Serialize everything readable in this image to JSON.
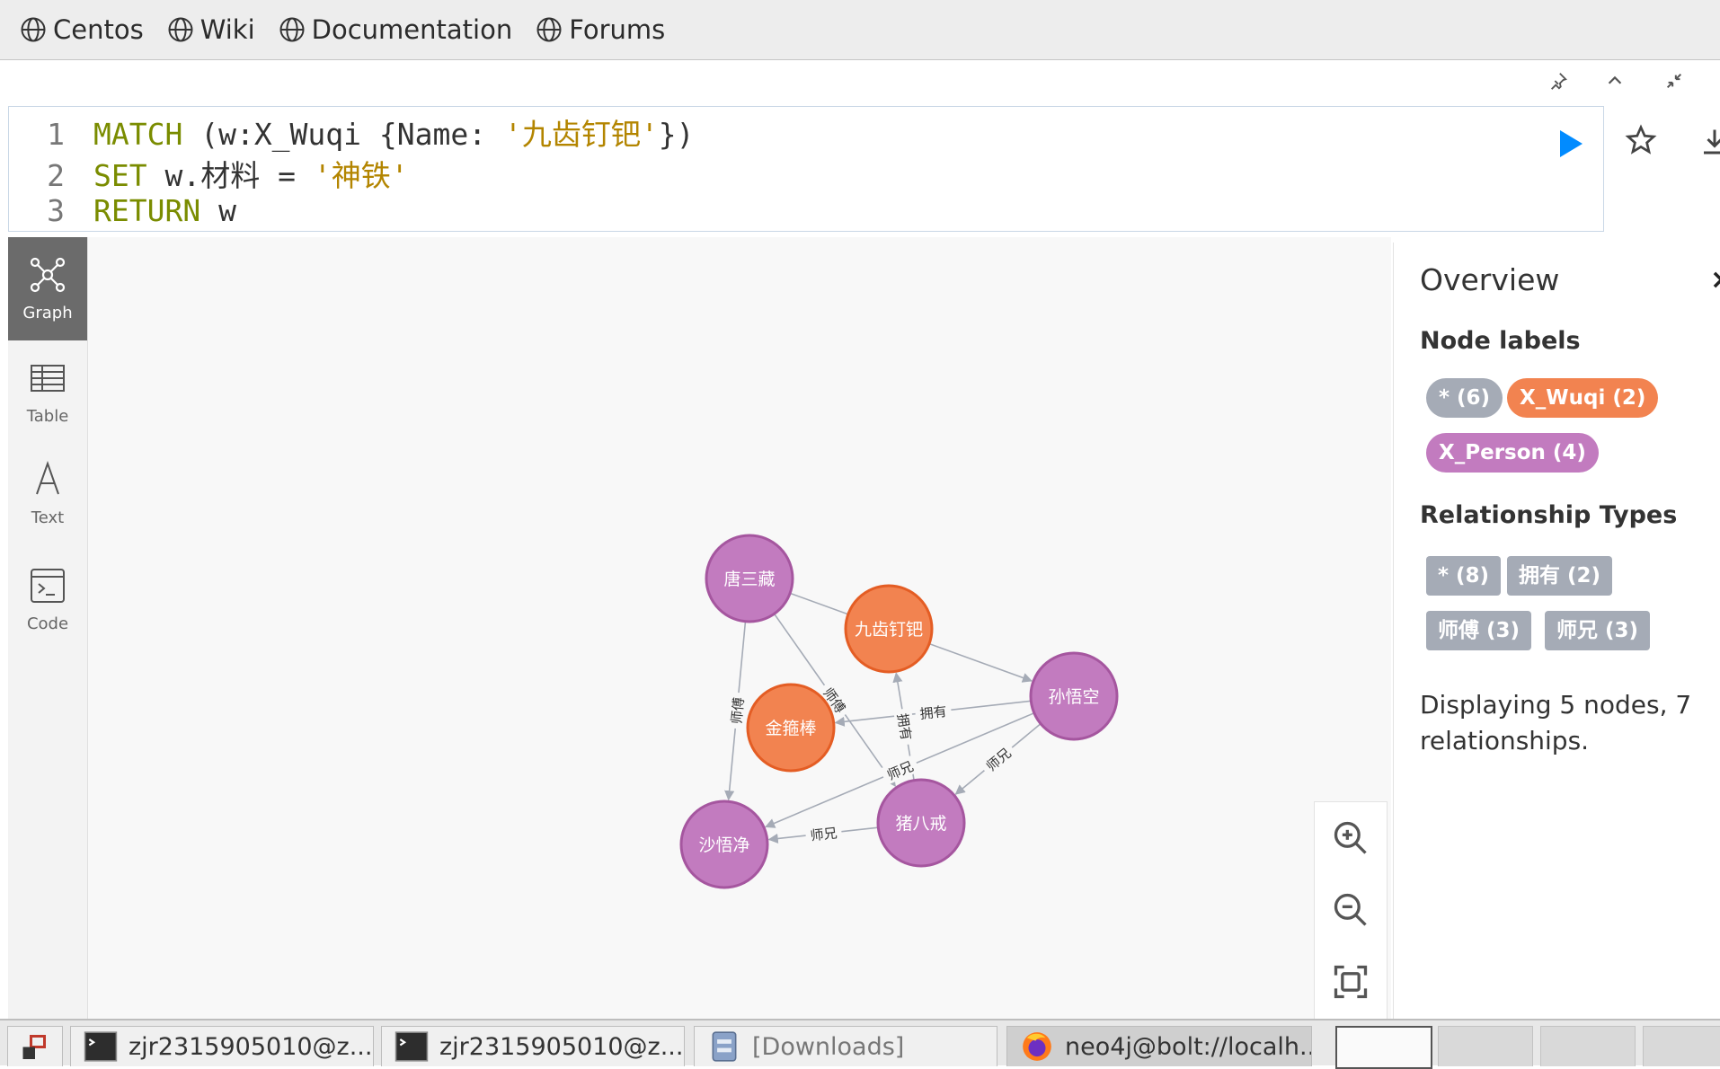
{
  "bookmarks": [
    {
      "label": "Centos",
      "icon": "globe-icon"
    },
    {
      "label": "Wiki",
      "icon": "globe-icon"
    },
    {
      "label": "Documentation",
      "icon": "globe-icon"
    },
    {
      "label": "Forums",
      "icon": "globe-icon"
    }
  ],
  "editor": {
    "line_numbers": [
      "1",
      "2",
      "3"
    ],
    "line1": {
      "kw": "MATCH",
      "mid": " (w:X_Wuqi {Name: ",
      "str": "'九齿钉钯'",
      "end": "})"
    },
    "line2": {
      "kw": "SET",
      "mid": " w.材料 = ",
      "str": "'神铁'"
    },
    "line3": {
      "kw": "RETURN",
      "mid": " w"
    }
  },
  "sidebar": {
    "graph": "Graph",
    "table": "Table",
    "text": "Text",
    "code": "Code"
  },
  "graph": {
    "nodes": [
      {
        "id": "tang",
        "label": "唐三藏",
        "type": "person"
      },
      {
        "id": "jiuchi",
        "label": "九齿钉钯",
        "type": "wuqi"
      },
      {
        "id": "sun",
        "label": "孙悟空",
        "type": "person"
      },
      {
        "id": "jingu",
        "label": "金箍棒",
        "type": "wuqi"
      },
      {
        "id": "zhu",
        "label": "猪八戒",
        "type": "person"
      },
      {
        "id": "sha",
        "label": "沙悟净",
        "type": "person"
      }
    ],
    "edges": [
      {
        "from": "tang",
        "to": "sun",
        "label": ""
      },
      {
        "from": "tang",
        "to": "sha",
        "label": "师傅"
      },
      {
        "from": "tang",
        "to": "zhu",
        "label": "师傅"
      },
      {
        "from": "sun",
        "to": "jingu",
        "label": "拥有"
      },
      {
        "from": "zhu",
        "to": "jiuchi",
        "label": "拥有"
      },
      {
        "from": "sun",
        "to": "zhu",
        "label": "师兄"
      },
      {
        "from": "sun",
        "to": "sha",
        "label": "师兄"
      },
      {
        "from": "zhu",
        "to": "sha",
        "label": "师兄"
      }
    ],
    "colors": {
      "person": "#c27bbf",
      "person_stroke": "#a5569f",
      "wuqi": "#f28350",
      "wuqi_stroke": "#e45d24",
      "edge": "#a5abb6"
    }
  },
  "overview": {
    "title": "Overview",
    "node_labels_heading": "Node labels",
    "node_labels": [
      {
        "label": "* (6)",
        "color": "#a5abb6"
      },
      {
        "label": "X_Wuqi (2)",
        "color": "#f28350"
      },
      {
        "label": "X_Person (4)",
        "color": "#c27bbf"
      }
    ],
    "rel_types_heading": "Relationship Types",
    "rel_types": [
      {
        "label": "* (8)"
      },
      {
        "label": "拥有 (2)"
      },
      {
        "label": "师傅 (3)"
      },
      {
        "label": "师兄 (3)"
      }
    ],
    "summary": "Displaying 5 nodes, 7 relationships."
  },
  "taskbar": {
    "tasks": [
      {
        "label": "zjr2315905010@z...",
        "icon": "terminal-icon"
      },
      {
        "label": "zjr2315905010@z...",
        "icon": "terminal-icon"
      },
      {
        "label": "[Downloads]",
        "icon": "file-manager-icon"
      },
      {
        "label": "neo4j@bolt://localh...",
        "icon": "firefox-icon"
      }
    ]
  }
}
